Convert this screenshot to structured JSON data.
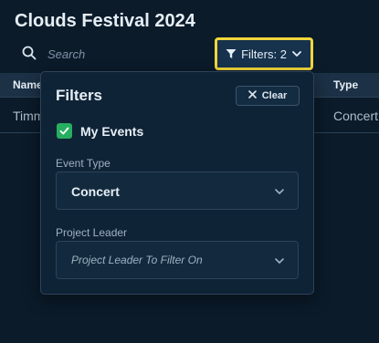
{
  "page": {
    "title": "Clouds Festival 2024"
  },
  "search": {
    "placeholder": "Search",
    "icon": "search-icon"
  },
  "filters_button": {
    "label": "Filters: 2",
    "icon": "filter-icon",
    "highlight_color": "#f2d63b"
  },
  "table": {
    "columns": [
      "Name",
      "Type"
    ],
    "rows": [
      {
        "name": "Timmy",
        "type": "Concert"
      }
    ]
  },
  "filters_panel": {
    "title": "Filters",
    "clear_label": "Clear",
    "my_events": {
      "label": "My Events",
      "checked": true,
      "color": "#27ae60"
    },
    "event_type": {
      "label": "Event Type",
      "value": "Concert"
    },
    "project_leader": {
      "label": "Project Leader",
      "placeholder": "Project Leader To Filter On"
    }
  }
}
